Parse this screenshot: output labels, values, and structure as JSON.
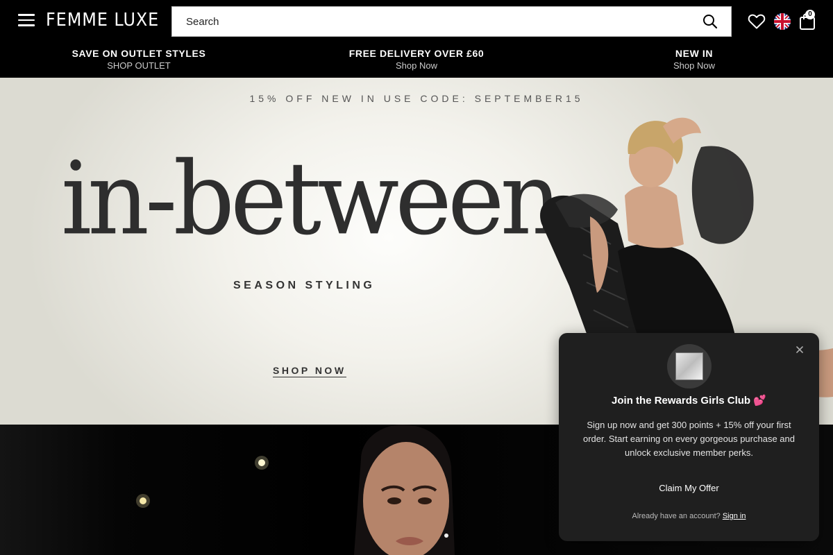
{
  "header": {
    "logo": "FEMME LUXE",
    "search_placeholder": "Search",
    "cart_count": "0",
    "icons": [
      "menu-icon",
      "search-icon",
      "heart-icon",
      "uk-flag-icon",
      "shopping-bag-icon"
    ]
  },
  "promos": [
    {
      "title": "SAVE ON OUTLET STYLES",
      "sub": "SHOP OUTLET"
    },
    {
      "title": "FREE DELIVERY OVER £60",
      "sub": "Shop Now"
    },
    {
      "title": "NEW IN",
      "sub": "Shop Now"
    }
  ],
  "hero": {
    "code_line": "15% OFF NEW IN   USE CODE: SEPTEMBER15",
    "title": "in-between",
    "subtitle": "SEASON STYLING",
    "cta": "SHOP NOW"
  },
  "popup": {
    "title": "Join the Rewards Girls Club 💕",
    "text": "Sign up now and get 300 points + 15% off your first order. Start earning on every gorgeous purchase and unlock exclusive member perks.",
    "button": "Claim My Offer",
    "footer_text": "Already have an account?",
    "footer_link": "Sign in"
  },
  "colors": {
    "header_bg": "#000000",
    "popup_bg": "#1f1f1f",
    "hero_text": "#2e2e2e"
  }
}
